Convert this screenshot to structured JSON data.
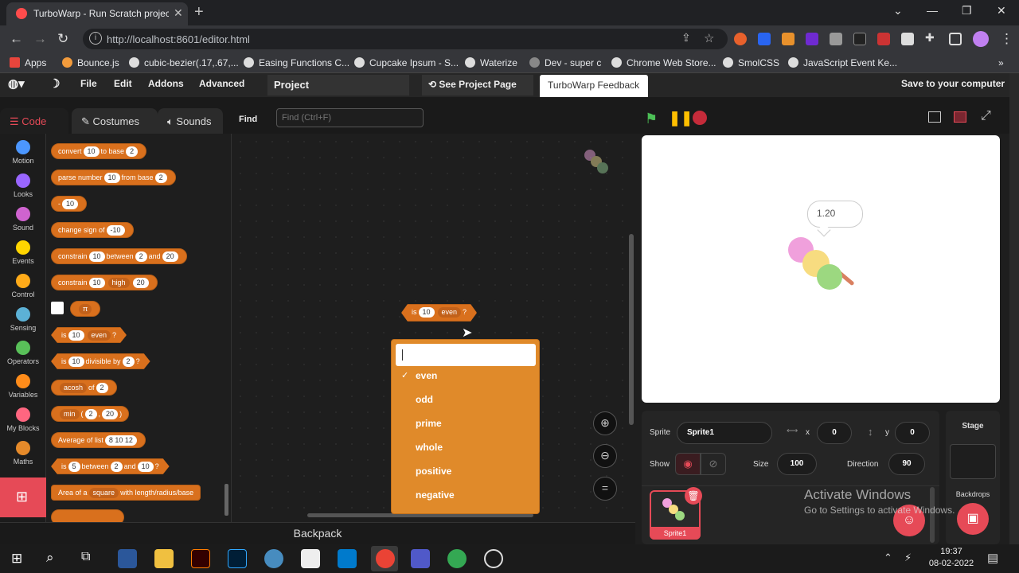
{
  "browser": {
    "tab_title": "TurboWarp - Run Scratch project",
    "url": "http://localhost:8601/editor.html",
    "bookmarks": [
      "Apps",
      "Bounce.js",
      "cubic-bezier(.17,.67,...",
      "Easing Functions C...",
      "Cupcake Ipsum - S...",
      "Waterize",
      "Dev - super c",
      "Chrome Web Store...",
      "SmolCSS",
      "JavaScript Event Ke..."
    ]
  },
  "menubar": {
    "file": "File",
    "edit": "Edit",
    "addons": "Addons",
    "advanced": "Advanced",
    "project": "Project",
    "see_page": "See Project Page",
    "feedback": "TurboWarp Feedback",
    "save": "Save to your computer"
  },
  "editor_tabs": {
    "code": "Code",
    "costumes": "Costumes",
    "sounds": "Sounds",
    "find": "Find",
    "find_placeholder": "Find (Ctrl+F)"
  },
  "categories": [
    {
      "label": "Motion",
      "color": "#4c97ff"
    },
    {
      "label": "Looks",
      "color": "#9966ff"
    },
    {
      "label": "Sound",
      "color": "#cf63cf"
    },
    {
      "label": "Events",
      "color": "#ffd500"
    },
    {
      "label": "Control",
      "color": "#ffab19"
    },
    {
      "label": "Sensing",
      "color": "#5cb1d6"
    },
    {
      "label": "Operators",
      "color": "#59c059"
    },
    {
      "label": "Variables",
      "color": "#ff8c1a"
    },
    {
      "label": "My Blocks",
      "color": "#ff6680"
    },
    {
      "label": "Maths",
      "color": "#e58a2a"
    }
  ],
  "palette": {
    "convert": [
      "convert",
      "10",
      "to base",
      "2"
    ],
    "parse": [
      "parse number",
      "10",
      "from base",
      "2"
    ],
    "neg": [
      "-",
      "10"
    ],
    "sign": [
      "change sign of",
      "-10"
    ],
    "constrain1": [
      "constrain",
      "10",
      "between",
      "2",
      "and",
      "20"
    ],
    "constrain2": [
      "constrain",
      "10",
      "high",
      "20"
    ],
    "pi": "π",
    "is_even": [
      "is",
      "10",
      "even",
      "?"
    ],
    "divisible": [
      "is",
      "10",
      "divisible by",
      "2",
      "?"
    ],
    "acosh": [
      "acosh",
      "of",
      "2"
    ],
    "min": [
      "min",
      "(",
      "2",
      ",",
      "20",
      ")"
    ],
    "average": [
      "Average of list",
      "8 10 12"
    ],
    "between": [
      "is",
      "5",
      "between",
      "2",
      "and",
      "10",
      "?"
    ],
    "area": [
      "Area of a",
      "square",
      "with length/radius/base"
    ]
  },
  "workspace_block": [
    "is",
    "10",
    "even",
    "?"
  ],
  "dropdown": {
    "selected": "even",
    "options": [
      "even",
      "odd",
      "prime",
      "whole",
      "positive",
      "negative"
    ]
  },
  "backpack": "Backpack",
  "stage": {
    "say": "1.20"
  },
  "sprite_info": {
    "sprite_label": "Sprite",
    "sprite_name": "Sprite1",
    "x_label": "x",
    "x": "0",
    "y_label": "y",
    "y": "0",
    "show_label": "Show",
    "size_label": "Size",
    "size": "100",
    "direction_label": "Direction",
    "direction": "90",
    "thumb_name": "Sprite1"
  },
  "stage_panel": {
    "title": "Stage",
    "backdrops": "Backdrops"
  },
  "watermark": {
    "line1": "Activate Windows",
    "line2": "Go to Settings to activate Windows."
  },
  "clock": {
    "time": "19:37",
    "date": "08-02-2022"
  }
}
